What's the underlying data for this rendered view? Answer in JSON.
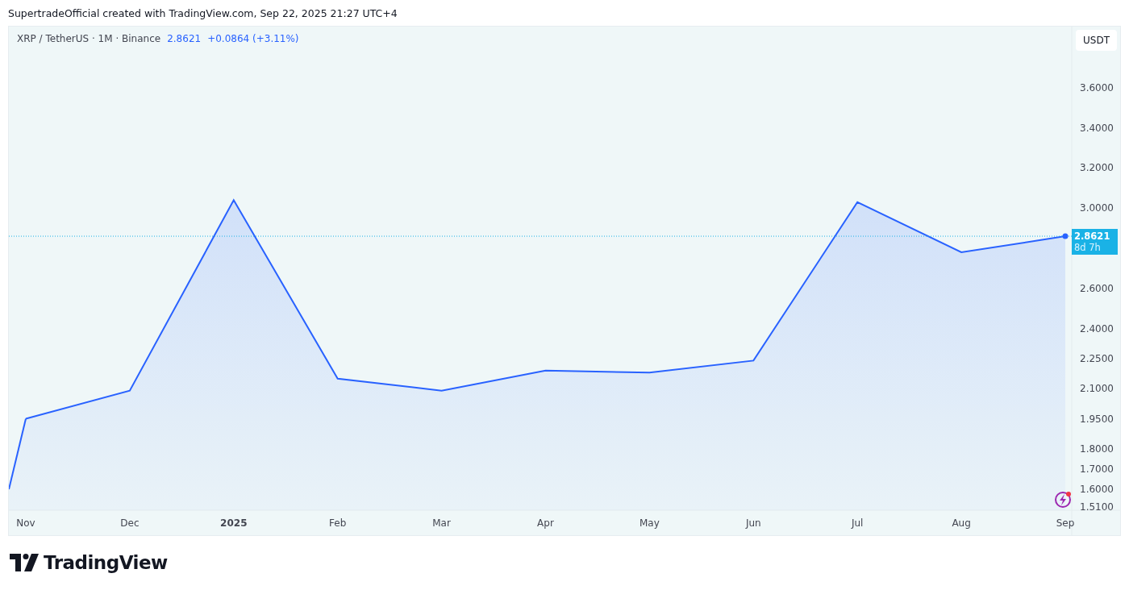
{
  "caption": "SupertradeOfficial created with TradingView.com, Sep 22, 2025 21:27 UTC+4",
  "legend": {
    "symbol": "XRP / TetherUS · 1M · Binance",
    "price": "2.8621",
    "change": "+0.0864 (+3.11%)"
  },
  "currency_button": "USDT",
  "last_price": {
    "price": "2.8621",
    "countdown": "8d 7h"
  },
  "chart": {
    "chart_data": {
      "type": "area",
      "categories": [
        "Nov",
        "Dec",
        "2025",
        "Feb",
        "Mar",
        "Apr",
        "May",
        "Jun",
        "Jul",
        "Aug",
        "Sep"
      ],
      "series": [
        {
          "color": "#2962ff",
          "values": [
            1.95,
            2.09,
            3.04,
            2.15,
            2.09,
            2.19,
            2.18,
            2.24,
            3.03,
            2.78,
            2.86
          ]
        }
      ],
      "ylim": [
        1.494,
        3.905
      ],
      "ref_lines": [
        {
          "axis": "y",
          "value": 2.86,
          "color": "#1ab2e6"
        }
      ],
      "yticks": [
        {
          "value": 3.6,
          "label": "3.6000"
        },
        {
          "value": 3.4,
          "label": "3.4000"
        },
        {
          "value": 3.2,
          "label": "3.2000"
        },
        {
          "value": 3.0,
          "label": "3.0000"
        },
        {
          "value": 2.6,
          "label": "2.6000"
        },
        {
          "value": 2.4,
          "label": "2.4000"
        },
        {
          "value": 2.25,
          "label": "2.2500"
        },
        {
          "value": 2.1,
          "label": "2.1000"
        },
        {
          "value": 1.95,
          "label": "1.9500"
        },
        {
          "value": 1.8,
          "label": "1.8000"
        },
        {
          "value": 1.7,
          "label": "1.7000"
        },
        {
          "value": 1.6,
          "label": "1.6000"
        },
        {
          "value": 1.51,
          "label": "1.5100"
        }
      ]
    }
  },
  "brand": "TradingView"
}
